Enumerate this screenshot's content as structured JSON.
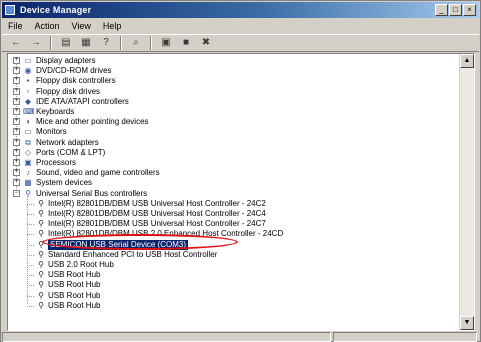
{
  "window": {
    "title": "Device Manager"
  },
  "title_buttons": [
    "_",
    "□",
    "×"
  ],
  "menubar": {
    "items": [
      "File",
      "Action",
      "View",
      "Help"
    ]
  },
  "toolbar": {
    "buttons": [
      {
        "name": "back-icon",
        "glyph": "←"
      },
      {
        "name": "forward-icon",
        "glyph": "→"
      },
      {
        "name": "properties-icon",
        "glyph": "▤"
      },
      {
        "name": "print-icon",
        "glyph": "▦"
      },
      {
        "name": "help-icon",
        "glyph": "?"
      },
      {
        "name": "scan-hardware-icon",
        "glyph": "⌕"
      },
      {
        "name": "update-driver-icon",
        "glyph": "▣"
      },
      {
        "name": "disable-device-icon",
        "glyph": "■"
      },
      {
        "name": "uninstall-device-icon",
        "glyph": "✖"
      }
    ]
  },
  "tree": {
    "categories": [
      {
        "label": "Display adapters",
        "icon": "monitor-icon",
        "expander": "+"
      },
      {
        "label": "DVD/CD-ROM drives",
        "icon": "dvd-drive-icon",
        "expander": "+"
      },
      {
        "label": "Floppy disk controllers",
        "icon": "floppy-controller-icon",
        "expander": "+"
      },
      {
        "label": "Floppy disk drives",
        "icon": "floppy-drive-icon",
        "expander": "+"
      },
      {
        "label": "IDE ATA/ATAPI controllers",
        "icon": "ide-controller-icon",
        "expander": "+"
      },
      {
        "label": "Keyboards",
        "icon": "keyboard-icon",
        "expander": "+"
      },
      {
        "label": "Mice and other pointing devices",
        "icon": "mouse-icon",
        "expander": "+"
      },
      {
        "label": "Monitors",
        "icon": "monitor-icon",
        "expander": "+"
      },
      {
        "label": "Network adapters",
        "icon": "network-adapter-icon",
        "expander": "+"
      },
      {
        "label": "Ports (COM & LPT)",
        "icon": "port-icon",
        "expander": "+"
      },
      {
        "label": "Processors",
        "icon": "processor-icon",
        "expander": "+"
      },
      {
        "label": "Sound, video and game controllers",
        "icon": "sound-icon",
        "expander": "+"
      },
      {
        "label": "System devices",
        "icon": "system-icon",
        "expander": "+"
      },
      {
        "label": "Universal Serial Bus controllers",
        "icon": "usb-icon",
        "expander": "−"
      }
    ],
    "usb_children": [
      {
        "label": "Intel(R) 82801DB/DBM USB Universal Host Controller - 24C2",
        "selected": false
      },
      {
        "label": "Intel(R) 82801DB/DBM USB Universal Host Controller - 24C4",
        "selected": false
      },
      {
        "label": "Intel(R) 82801DB/DBM USB Universal Host Controller - 24C7",
        "selected": false
      },
      {
        "label": "Intel(R) 82801DB/DBM USB 2.0 Enhanced Host Controller - 24CD",
        "selected": false
      },
      {
        "label": "SEMICON USB Serial Device (COM3)",
        "selected": true
      },
      {
        "label": "Standard Enhanced PCI to USB Host Controller",
        "selected": false
      },
      {
        "label": "USB 2.0 Root Hub",
        "selected": false
      },
      {
        "label": "USB Root Hub",
        "selected": false
      },
      {
        "label": "USB Root Hub",
        "selected": false
      },
      {
        "label": "USB Root Hub",
        "selected": false
      },
      {
        "label": "USB Root Hub",
        "selected": false
      }
    ]
  },
  "scrollbar": {
    "up": "▲",
    "down": "▼"
  },
  "colors": {
    "selection": "#0a246a",
    "highlight_ring": "#e01010",
    "title_gradient_start": "#0a246a"
  }
}
